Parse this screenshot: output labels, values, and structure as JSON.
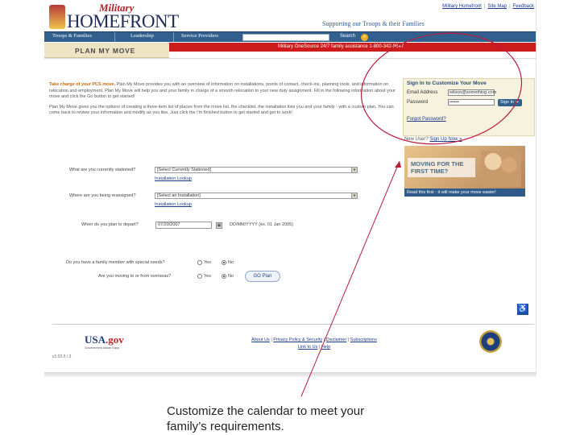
{
  "header": {
    "brand_military": "Military",
    "brand_homefront": "HOMEFRONT",
    "tagline": "Supporting our Troops & their Families",
    "toplinks": [
      "Military Homefront",
      "|",
      "Site Map",
      "|",
      "Feedback"
    ]
  },
  "nav": {
    "items": [
      "Troops & Families",
      "Leadership",
      "Service Providers"
    ],
    "search_label": "Search",
    "go": "»"
  },
  "banner": {
    "plan_title": "PLAN MY MOVE",
    "onesource": "Military OneSource 24/7 family assistance 1-800-342-9647"
  },
  "intro": {
    "lead": "Take charge of your PCS move.",
    "para1": " Plan My Move provides you with an overview of information on installations, points of contact, check-ins, planning tools, and information on relocation and employment. Plan My Move will help you and your family in charge of a smooth relocation to your new duty assignment. Fill in the following information about your move and click the Go button to get started!",
    "para2": "Plan My Move gives you the options of creating a three-item list of places from the move list, the checklist, the installation lists you and your family - with a custom plan. You can come back to review your information and modify as you like. Just click the I'm finished button to get started and get to work!"
  },
  "signin": {
    "title": "Sign In to Customize Your Move",
    "email_label": "Email Address",
    "email_value": "wilson@something.com",
    "password_label": "Password",
    "password_value": "••••••",
    "button": "Sign In ►",
    "forgot": "Forgot Password?",
    "new_user": "New User?",
    "signup": "Sign Up Now »"
  },
  "promo": {
    "text": "MOVING FOR THE FIRST TIME?",
    "caption": "Read this first - it will make your move easier!"
  },
  "form": {
    "q1_label": "What are you currently stationed?",
    "q1_value": "[Select Currently Stationed]",
    "q1_link": "Installation Lookup",
    "q2_label": "Where are you being reassigned?",
    "q2_value": "[Select an Installation]",
    "q2_link": "Installation Lookup",
    "q3_label": "When do you plan to depart?",
    "q3_value": "07/20/2007",
    "q3_hint": "DD/MM/YYYY (ex. 01 Jan 2005)",
    "q4_label": "Do you have a family member with special needs?",
    "q5_label": "Are you moving to or from overseas?",
    "yes": "Yes",
    "no": "No",
    "go_button": "GO Plan"
  },
  "footer": {
    "usa": "USA",
    "gov": ".gov",
    "usa_sub": "Government Made Easy",
    "links_line1": [
      "About Us",
      "Privacy Policy & Security",
      "Disclaimer",
      "Subscriptions"
    ],
    "links_line2": [
      "Link to Us",
      "Help"
    ],
    "version": "v1.02.0 / 3"
  },
  "annotation": {
    "line1": "Customize the calendar to meet your",
    "line2": "family’s requirements.",
    "ellipse_color": "#b71c3a",
    "arrow_color": "#b71c3a"
  }
}
